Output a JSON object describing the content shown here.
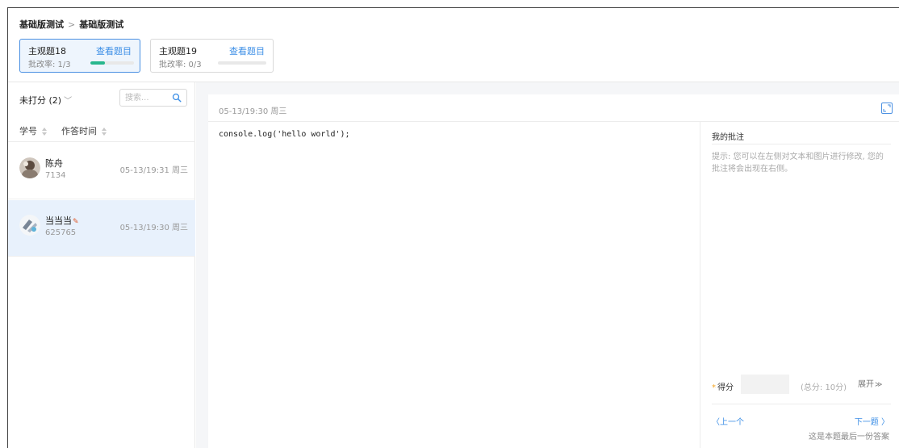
{
  "breadcrumb": {
    "first": "基础版测试",
    "separator": ">",
    "second": "基础版测试"
  },
  "questions": [
    {
      "title": "主观题18",
      "view_label": "查看题目",
      "rate": "批改率: 1/3",
      "progress": 0.333
    },
    {
      "title": "主观题19",
      "view_label": "查看题目",
      "rate": "批改率: 0/3",
      "progress": 0
    }
  ],
  "filter": {
    "label": "未打分 (2)",
    "search_placeholder": "搜索..."
  },
  "sort": {
    "col_id": "学号",
    "col_time": "作答时间"
  },
  "students": [
    {
      "name": "陈舟",
      "id": "7134",
      "time": "05-13/19:31 周三"
    },
    {
      "name": "当当当",
      "id": "625765",
      "time": "05-13/19:30 周三"
    }
  ],
  "answer": {
    "time": "05-13/19:30 周三",
    "code": "console.log('hello world');"
  },
  "annotation": {
    "title": "我的批注",
    "hint": "提示: 您可以在左侧对文本和图片进行修改, 您的批注将会出现在右侧。"
  },
  "score": {
    "required_mark": "*",
    "label": "得分",
    "total": "(总分: 10分)",
    "expand": "展开"
  },
  "nav": {
    "prev": "上一个",
    "next": "下一题",
    "note": "这是本题最后一份答案"
  },
  "colors": {
    "accent": "#3b8ee6",
    "progress": "#28b78d",
    "selected_bg": "#e8f1fc",
    "required": "#f5a623"
  }
}
